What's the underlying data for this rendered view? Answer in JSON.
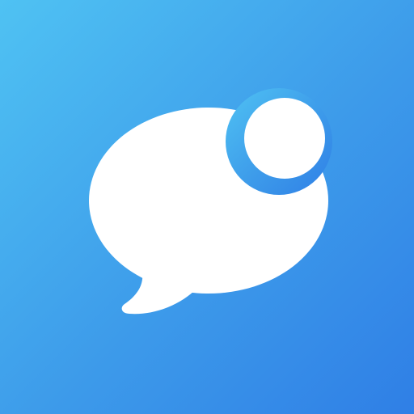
{
  "app_icon": {
    "icon": "chat-bubble-notification-icon",
    "gradient_start": "#4fc2f3",
    "gradient_mid": "#3d9bea",
    "gradient_end": "#2f7fe6",
    "foreground": "#ffffff"
  }
}
